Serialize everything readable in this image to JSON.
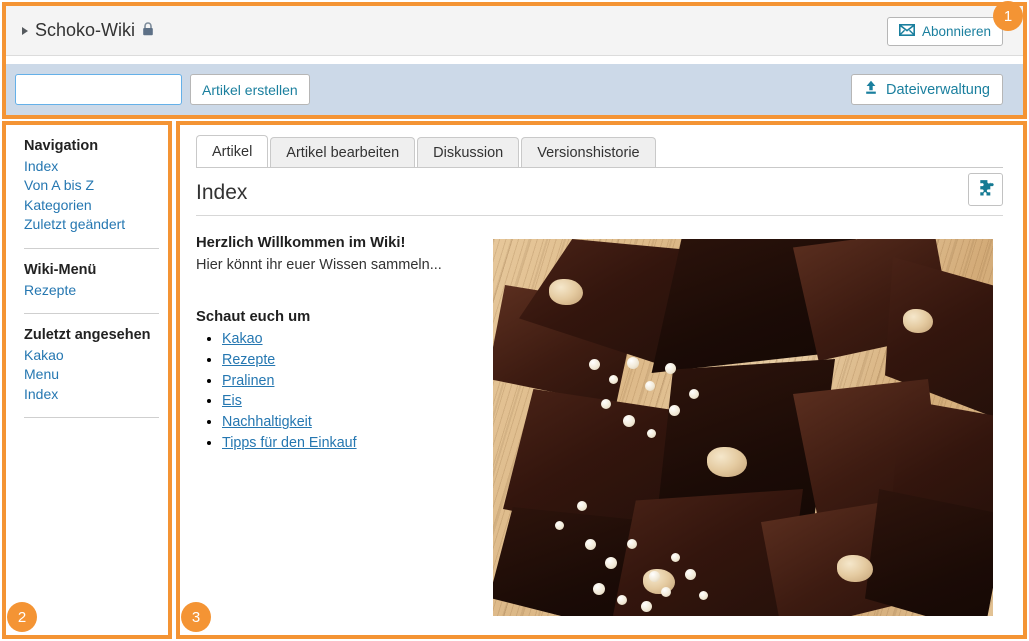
{
  "header": {
    "wiki_title": "Schoko-Wiki",
    "lock_icon": "lock-icon",
    "toggle_icon": "triangle-right-icon",
    "subscribe_label": "Abonnieren",
    "subscribe_icon": "envelope-icon"
  },
  "toolbar": {
    "search_value": "",
    "search_placeholder": "",
    "create_article_label": "Artikel erstellen",
    "file_management_label": "Dateiverwaltung",
    "file_management_icon": "upload-icon"
  },
  "sidebar": {
    "groups": [
      {
        "heading": "Navigation",
        "links": [
          "Index",
          "Von A bis Z",
          "Kategorien",
          "Zuletzt geändert"
        ]
      },
      {
        "heading": "Wiki-Menü",
        "links": [
          "Rezepte"
        ]
      },
      {
        "heading": "Zuletzt angesehen",
        "links": [
          "Kakao",
          "Menu",
          "Index"
        ]
      }
    ]
  },
  "main": {
    "tabs": [
      {
        "label": "Artikel",
        "active": true
      },
      {
        "label": "Artikel bearbeiten",
        "active": false
      },
      {
        "label": "Diskussion",
        "active": false
      },
      {
        "label": "Versionshistorie",
        "active": false
      }
    ],
    "article_title": "Index",
    "puzzle_button_icon": "puzzle-piece-icon",
    "welcome_heading": "Herzlich Willkommen im Wiki!",
    "welcome_text": "Hier könnt ihr euer Wissen sammeln...",
    "browse_heading": "Schaut euch um",
    "browse_links": [
      "Kakao",
      "Rezepte",
      "Pralinen",
      "Eis",
      "Nachhaltigkeit",
      "Tipps für den Einkauf"
    ],
    "photo_alt": "chocolate-bark-photo"
  },
  "annotations": {
    "badges": [
      "1",
      "2",
      "3"
    ],
    "accent_color": "#f49434"
  },
  "colors": {
    "accent_orange": "#f49434",
    "toolbar_blue": "#ccd9e8",
    "link_blue": "#2577b1",
    "action_teal": "#1a7f9e",
    "header_gray": "#f4f4f4"
  }
}
